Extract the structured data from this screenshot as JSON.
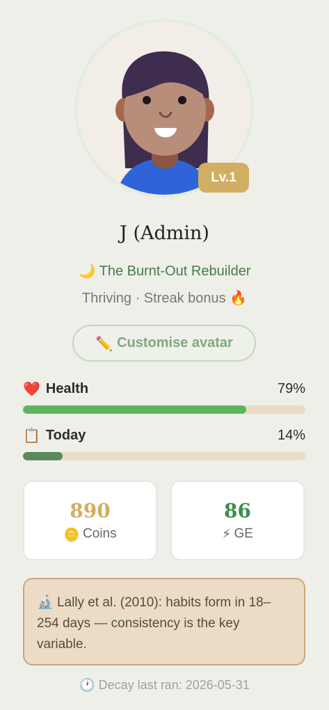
{
  "profile": {
    "name": "J (Admin)",
    "level_badge": "Lv.1",
    "archetype_icon": "🌙",
    "archetype": "The Burnt-Out Rebuilder",
    "status": "Thriving · Streak bonus",
    "status_icon": "🔥"
  },
  "customise": {
    "icon": "✏️",
    "label": "Customise avatar"
  },
  "stats": {
    "health": {
      "icon": "❤️",
      "label": "Health",
      "value_text": "79%",
      "value": 0.79,
      "color": "#5fb55f"
    },
    "today": {
      "icon": "📋",
      "label": "Today",
      "value_text": "14%",
      "value": 0.14,
      "color": "#5a8a5c"
    }
  },
  "cards": {
    "coins": {
      "value": "890",
      "icon": "🪙",
      "label": "Coins",
      "color": "#d2ae62"
    },
    "ge": {
      "value": "86",
      "icon": "⚡",
      "label": "GE",
      "color": "#3d8d4c"
    }
  },
  "tip": {
    "icon": "🔬",
    "text": "Lally et al. (2010): habits form in 18–254 days — consistency is the key variable."
  },
  "decay": {
    "icon": "🕐",
    "text": "Decay last ran: 2026-05-31"
  }
}
